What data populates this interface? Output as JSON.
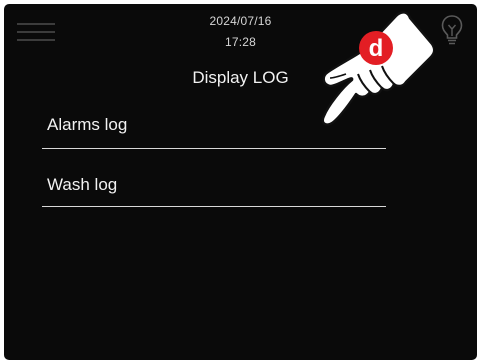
{
  "header": {
    "date": "2024/07/16",
    "time": "17:28",
    "menu_icon": "hamburger-menu-icon",
    "bulb_icon": "lightbulb-icon"
  },
  "page": {
    "title": "Display LOG"
  },
  "list": {
    "items": [
      {
        "label": "Alarms log"
      },
      {
        "label": "Wash log"
      }
    ]
  },
  "overlay": {
    "hand_icon": "pointing-hand-icon",
    "badge_letter": "d",
    "badge_color": "#e31e24"
  },
  "colors": {
    "background": "#0a0a0a",
    "text": "#f2f2f2",
    "divider": "#d8d8d8",
    "icon_dim": "#3c3c3c"
  }
}
